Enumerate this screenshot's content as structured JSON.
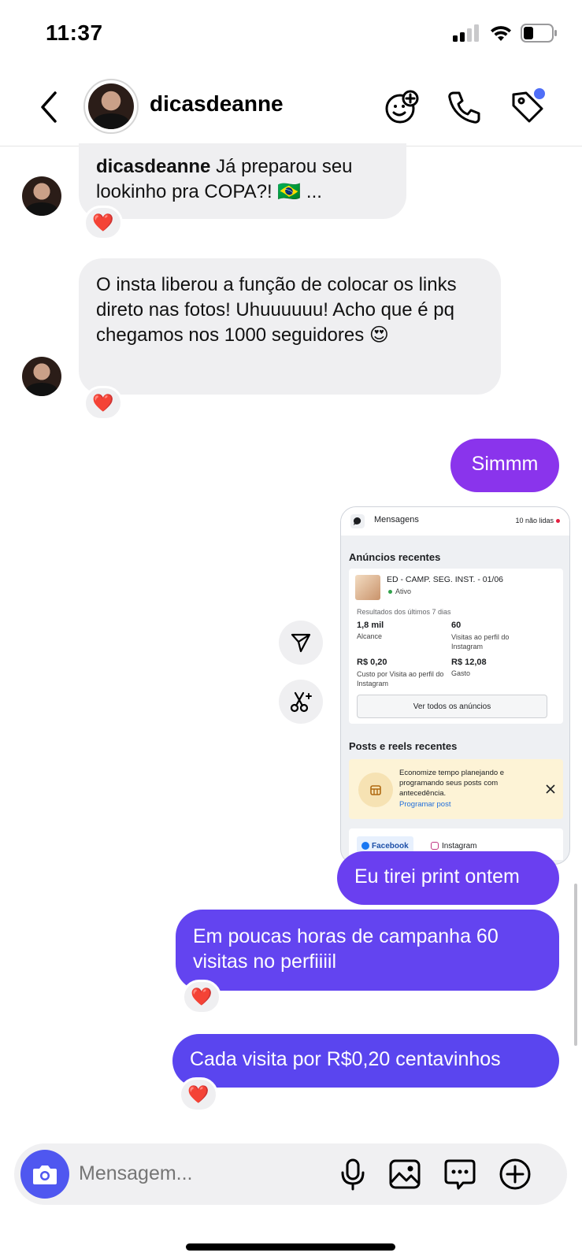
{
  "status_bar": {
    "time": "11:37"
  },
  "header": {
    "username": "dicasdeanne"
  },
  "messages": {
    "m1": {
      "sender": "dicasdeanne",
      "text": "Já preparou seu lookinho pra COPA?! 🇧🇷 ..."
    },
    "m2": {
      "text": "O insta liberou a função de colocar os links direto nas fotos! Uhuuuuuu! Acho que é pq chegamos nos 1000 seguidores 😍"
    },
    "m3": {
      "text": "Simmm"
    },
    "m4": {
      "text": "Eu tirei print ontem"
    },
    "m5": {
      "text": "Em poucas horas de campanha 60 visitas no perfiiiil"
    },
    "m6": {
      "text": "Cada visita por R$0,20 centavinhos"
    }
  },
  "reaction": "❤️",
  "screenshot": {
    "title": "Mensagens",
    "unread": "10 não lidas",
    "ads_heading": "Anúncios recentes",
    "ad_name": "ED - CAMP. SEG. INST. - 01/06",
    "ad_status": "Ativo",
    "results_label": "Resultados dos últimos 7 dias",
    "reach_value": "1,8 mil",
    "reach_label": "Alcance",
    "visits_value": "60",
    "visits_label": "Visitas ao perfil do Instagram",
    "cpv_value": "R$ 0,20",
    "cpv_label": "Custo por Visita ao perfil do Instagram",
    "spend_value": "R$ 12,08",
    "spend_label": "Gasto",
    "view_all_button": "Ver todos os anúncios",
    "posts_heading": "Posts e reels recentes",
    "tip_text": "Economize tempo planejando e programando seus posts com antecedência.",
    "tip_link": "Programar post",
    "tab_facebook": "Facebook",
    "tab_instagram": "Instagram"
  },
  "composer": {
    "placeholder": "Mensagem..."
  },
  "colors": {
    "accent": "#4f57f0",
    "bubble_purple_top": "#8a34ec",
    "bubble_purple_bottom": "#5a45ef",
    "bubble_incoming": "#efeff1"
  }
}
